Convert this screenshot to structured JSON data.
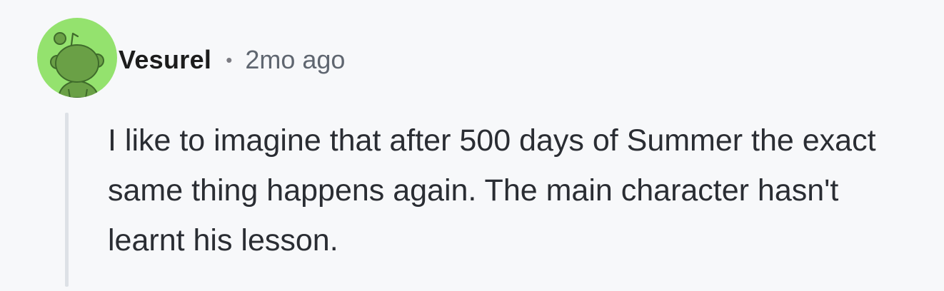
{
  "comment": {
    "username": "Vesurel",
    "separator": "•",
    "timestamp": "2mo ago",
    "body": "I like to imagine that after 500 days of Summer the exact same thing happens again. The main character hasn't learnt his lesson.",
    "avatar": {
      "icon": "reddit-snoo-avatar-icon",
      "background_color": "#94e26e",
      "figure_color": "#6aa046"
    },
    "thread_line_color": "#dde1e6"
  }
}
